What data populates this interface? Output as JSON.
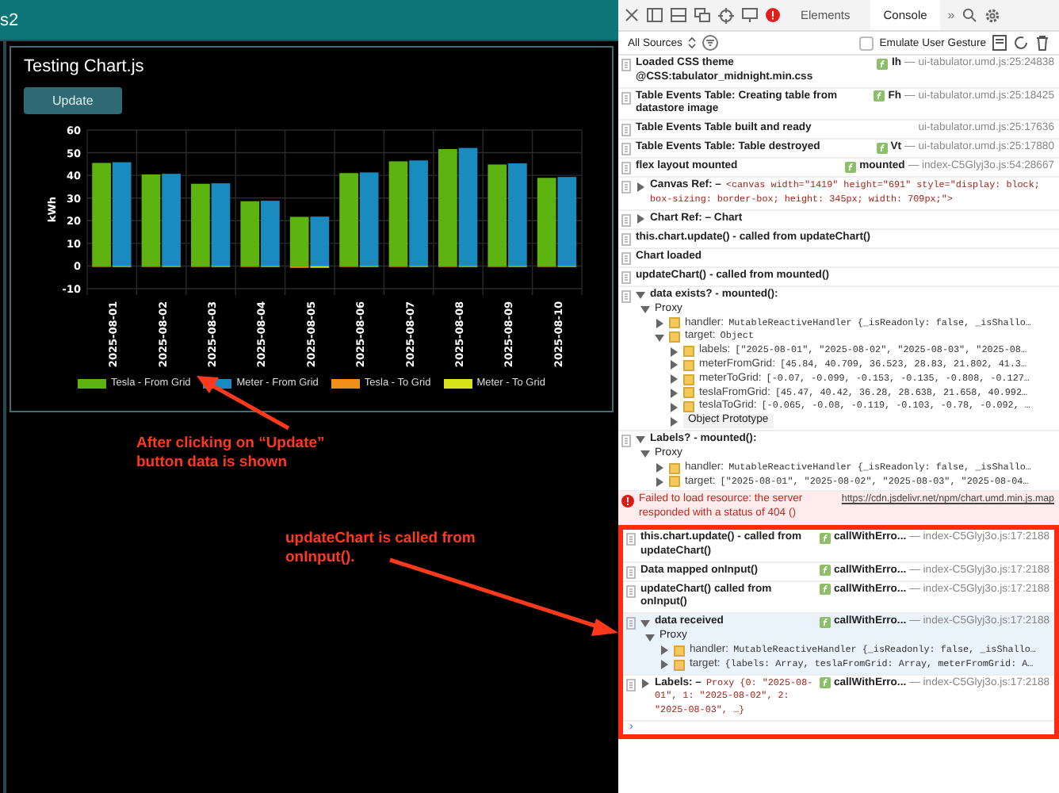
{
  "app": {
    "header_text": "s2",
    "card": {
      "title": "Testing Chart.js",
      "button": "Update",
      "chart_data": {
        "type": "bar",
        "ylabel": "kWh",
        "categories": [
          "2025-08-01",
          "2025-08-02",
          "2025-08-03",
          "2025-08-04",
          "2025-08-05",
          "2025-08-06",
          "2025-08-07",
          "2025-08-08",
          "2025-08-09",
          "2025-08-10"
        ],
        "ylim": [
          -10,
          60
        ],
        "grid": true,
        "yticks": [
          -10,
          0,
          10,
          20,
          30,
          40,
          50,
          60
        ],
        "series": [
          {
            "name": "Tesla - From Grid",
            "color": "#5db30f",
            "values": [
              45.5,
              40.4,
              36.3,
              28.6,
              21.7,
              41,
              46.2,
              51.6,
              44.8,
              38.9
            ]
          },
          {
            "name": "Meter - From Grid",
            "color": "#1a8bbf",
            "values": [
              45.8,
              40.7,
              36.5,
              28.8,
              21.8,
              41.3,
              46.6,
              52.1,
              45.3,
              39.3
            ]
          },
          {
            "name": "Tesla - To Grid",
            "color": "#f0901a",
            "values": [
              -0.1,
              -0.1,
              -0.1,
              -0.1,
              -0.8,
              -0.1,
              -0.1,
              -0.1,
              -0.1,
              -0.1
            ]
          },
          {
            "name": "Meter - To Grid",
            "color": "#d8e21a",
            "values": [
              -0.1,
              -0.1,
              -0.2,
              -0.1,
              -0.8,
              -0.1,
              -0.1,
              -0.1,
              -0.1,
              -0.1
            ]
          }
        ]
      }
    }
  },
  "annotations": [
    {
      "text": "After clicking on “Update” button data is shown"
    },
    {
      "text": "updateChart is called from onInput()."
    }
  ],
  "devtools": {
    "tabs": [
      {
        "label": "Elements",
        "selected": false
      },
      {
        "label": "Console",
        "selected": true
      }
    ],
    "more": "»",
    "filter": {
      "source": "All Sources",
      "emulate": {
        "label": "Emulate User Gesture",
        "checked": false
      }
    },
    "entries": [
      {
        "kind": "log",
        "text": "Loaded CSS theme @CSS:tabulator_midnight.min.css",
        "func": "Ih",
        "source": "— ui-tabulator.umd.js:25:24838",
        "boxed": false
      },
      {
        "kind": "log",
        "text": "Table Events Table: Creating table from datastore image",
        "func": "Fh",
        "source": "— ui-tabulator.umd.js:25:18425",
        "boxed": false
      },
      {
        "kind": "log",
        "text": "Table Events Table built and ready",
        "source": "ui-tabulator.umd.js:25:17636",
        "boxed": false
      },
      {
        "kind": "log",
        "text": "Table Events Table: Table destroyed",
        "func": "Vt",
        "source": "— ui-tabulator.umd.js:25:17880",
        "boxed": false
      },
      {
        "kind": "log",
        "text": "flex layout mounted",
        "func": "mounted",
        "source": "— index-C5Glyj3o.js:54:28667",
        "boxed": false
      },
      {
        "kind": "object",
        "text": "Canvas Ref: –",
        "preview": "<canvas width=\"1419\" height=\"691\" style=\"display: block; box-sizing: border-box; height: 345px; width: 709px;\">",
        "expanded": false,
        "boxed": false
      },
      {
        "kind": "object",
        "text": "Chart Ref: – Chart",
        "expanded": false,
        "boxed": false
      },
      {
        "kind": "log",
        "text": "this.chart.update() - called from updateChart()",
        "boxed": false
      },
      {
        "kind": "log",
        "text": "Chart loaded",
        "boxed": false
      },
      {
        "kind": "log",
        "text": "updateChart() - called from mounted()",
        "boxed": false
      },
      {
        "kind": "object",
        "text": "data exists? - mounted():",
        "expanded": true,
        "boxed": false,
        "children": [
          {
            "kind": "proxy",
            "label": "Proxy",
            "expanded": true,
            "children": [
              {
                "kind": "prop",
                "key": "handler:",
                "value": "MutableReactiveHandler {_isReadonly: false, _isShallo…",
                "expanded": false
              },
              {
                "kind": "prop",
                "key": "target:",
                "value": "Object",
                "expanded": true,
                "children": [
                  {
                    "kind": "prop",
                    "key": "labels:",
                    "value": "[\"2025-08-01\", \"2025-08-02\", \"2025-08-03\", \"2025-08…",
                    "expanded": false
                  },
                  {
                    "kind": "prop",
                    "key": "meterFromGrid:",
                    "value": "[45.84, 40.709, 36.523, 28.83, 21.802, 41.3…",
                    "expanded": false
                  },
                  {
                    "kind": "prop",
                    "key": "meterToGrid:",
                    "value": "[-0.07, -0.099, -0.153, -0.135, -0.808, -0.127…",
                    "expanded": false
                  },
                  {
                    "kind": "prop",
                    "key": "teslaFromGrid:",
                    "value": "[45.47, 40.42, 36.28, 28.638, 21.658, 40.992…",
                    "expanded": false
                  },
                  {
                    "kind": "prop",
                    "key": "teslaToGrid:",
                    "value": "[-0.065, -0.08, -0.119, -0.103, -0.78, -0.092, …",
                    "expanded": false
                  },
                  {
                    "kind": "proto",
                    "label": "Object Prototype",
                    "expanded": false
                  }
                ]
              }
            ]
          }
        ]
      },
      {
        "kind": "object",
        "text": "Labels? - mounted():",
        "expanded": true,
        "boxed": false,
        "children": [
          {
            "kind": "proxy",
            "label": "Proxy",
            "expanded": true,
            "children": [
              {
                "kind": "prop",
                "key": "handler:",
                "value": "MutableReactiveHandler {_isReadonly: false, _isShallo…",
                "expanded": false
              },
              {
                "kind": "prop",
                "key": "target:",
                "value": "[\"2025-08-01\", \"2025-08-02\", \"2025-08-03\", \"2025-08-04…",
                "expanded": false
              }
            ]
          }
        ]
      },
      {
        "kind": "error",
        "text": "Failed to load resource: the server responded with a status of 404 ()",
        "link": "https://cdn.jsdelivr.net/npm/chart.umd.min.js.map",
        "boxed": false
      },
      {
        "kind": "log",
        "text": "this.chart.update() - called from updateChart()",
        "func": "callWithErro...",
        "source": "— index-C5Glyj3o.js:17:2188",
        "boxed": true
      },
      {
        "kind": "log",
        "text": "Data mapped onInput()",
        "func": "callWithErro...",
        "source": "— index-C5Glyj3o.js:17:2188",
        "boxed": true
      },
      {
        "kind": "log",
        "text": "updateChart() called from onInput()",
        "func": "callWithErro...",
        "source": "— index-C5Glyj3o.js:17:2188",
        "boxed": true
      },
      {
        "kind": "object",
        "text": "data received",
        "func": "callWithErro...",
        "source": "— index-C5Glyj3o.js:17:2188",
        "expanded": true,
        "boxed": true,
        "children": [
          {
            "kind": "proxy",
            "label": "Proxy",
            "expanded": true,
            "children": [
              {
                "kind": "prop",
                "key": "handler:",
                "value": "MutableReactiveHandler {_isReadonly: false, _isShallo…",
                "expanded": false
              },
              {
                "kind": "prop",
                "key": "target:",
                "value": "{labels: Array, teslaFromGrid: Array, meterFromGrid: A…",
                "expanded": false
              }
            ]
          }
        ]
      },
      {
        "kind": "object",
        "text": "Labels: –",
        "preview": "Proxy {0: \"2025-08-01\", 1: \"2025-08-02\", 2: \"2025-08-03\", …}",
        "func": "callWithErro...",
        "source": "— index-C5Glyj3o.js:17:2188",
        "expanded": false,
        "boxed": true
      }
    ],
    "prompt": "›"
  }
}
